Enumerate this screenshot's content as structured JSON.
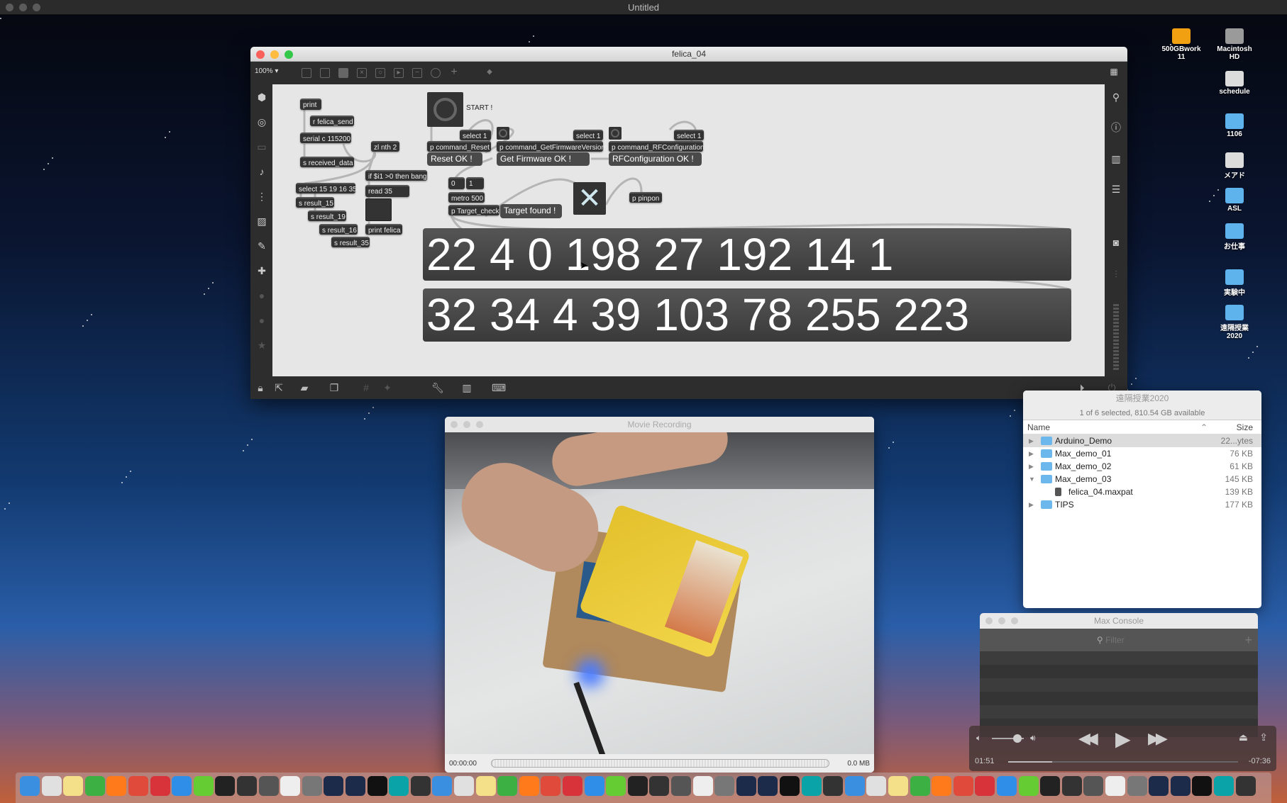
{
  "menubar": {
    "title": "Untitled"
  },
  "desktop_icons": [
    {
      "label": "500GBwork\n11",
      "kind": "drive-orange"
    },
    {
      "label": "Macintosh\nHD",
      "kind": "drive-gray"
    },
    {
      "label": "schedule",
      "kind": "document"
    },
    {
      "label": "1106",
      "kind": "folder"
    },
    {
      "label": "メアド",
      "kind": "document"
    },
    {
      "label": "ASL",
      "kind": "folder"
    },
    {
      "label": "お仕事",
      "kind": "folder"
    },
    {
      "label": "実験中",
      "kind": "folder"
    },
    {
      "label": "遠隔授業\n2020",
      "kind": "folder"
    }
  ],
  "max": {
    "title": "felica_04",
    "zoom": "100%",
    "objects": {
      "print": "print",
      "r_felica_send": "r felica_send",
      "serial": "serial c 115200",
      "zl_nth": "zl nth 2",
      "s_received": "s received_data",
      "if_bang": "if $i1 >0 then bang",
      "read35": "read 35",
      "select_multi": "select 15 19 16 35",
      "s15": "s result_15",
      "s19": "s result_19",
      "s16": "s result_16",
      "s35": "s result_35",
      "print_felica": "print felica",
      "start_label": "START !",
      "select1a": "select 1",
      "p_reset": "p command_Reset",
      "reset_ok": "Reset OK !",
      "p_fw": "p command_GetFirmwareVersion",
      "fw_ok": "Get Firmware OK !",
      "select1b": "select 1",
      "p_rf": "p command_RFConfiguration",
      "rf_ok": "RFConfiguration OK !",
      "select1c": "select 1",
      "msg0": "0",
      "msg1": "1",
      "metro": "metro 500",
      "p_target": "p Target_check",
      "target_found": "Target found !",
      "p_pinpon": "p pinpon"
    },
    "display1": "22 4 0 198 27 192 14 1",
    "display2": "32 34 4 39 103 78 255 223"
  },
  "finder": {
    "title": "遠隔授業2020",
    "status": "1 of 6 selected, 810.54 GB available",
    "col_name": "Name",
    "col_size": "Size",
    "rows": [
      {
        "name": "Arduino_Demo",
        "size": "22...ytes",
        "arrow": "▶",
        "type": "folder"
      },
      {
        "name": "Max_demo_01",
        "size": "76 KB",
        "arrow": "▶",
        "type": "folder"
      },
      {
        "name": "Max_demo_02",
        "size": "61 KB",
        "arrow": "▶",
        "type": "folder"
      },
      {
        "name": "Max_demo_03",
        "size": "145 KB",
        "arrow": "▼",
        "type": "folder"
      },
      {
        "name": "felica_04.maxpat",
        "size": "139 KB",
        "arrow": "",
        "type": "file"
      },
      {
        "name": "TIPS",
        "size": "177 KB",
        "arrow": "▶",
        "type": "folder"
      }
    ]
  },
  "movie": {
    "title": "Movie Recording",
    "time": "00:00:00",
    "size": "0.0 MB"
  },
  "console": {
    "title": "Max Console",
    "filter_placeholder": "Filter"
  },
  "player": {
    "elapsed": "01:51",
    "remaining": "-07:36",
    "progress": 0.19,
    "volume": 0.8
  },
  "dock": {
    "apps": [
      "finder",
      "preview",
      "notes",
      "numbers",
      "firefox",
      "chrome",
      "vivaldi",
      "safari",
      "app",
      "terminal",
      "max",
      "audio",
      "pd",
      "cube",
      "processing",
      "p",
      "p3",
      "arduino",
      "app2",
      "piano",
      "app3",
      "app4",
      "vectorworks",
      "triangle",
      "app5",
      "app6",
      "app7",
      "app8",
      "app9",
      "piano2",
      "itunes",
      "flash",
      "guitar",
      "todo",
      "app10",
      "app11",
      "app12",
      "app13",
      "app14",
      "app15",
      "app16",
      "clapper",
      "downloads",
      "app17",
      "app18",
      "vlc",
      "app19",
      "app20",
      "gmail",
      "zoom",
      "monitor",
      "app21",
      "wifi",
      "settings",
      "app22",
      "app23",
      "trash"
    ]
  },
  "colors": {
    "desktop_top": "#05070f",
    "max_panel": "#2d2d2d",
    "max_canvas": "#e6e6e6",
    "folder": "#6cb8ec"
  }
}
